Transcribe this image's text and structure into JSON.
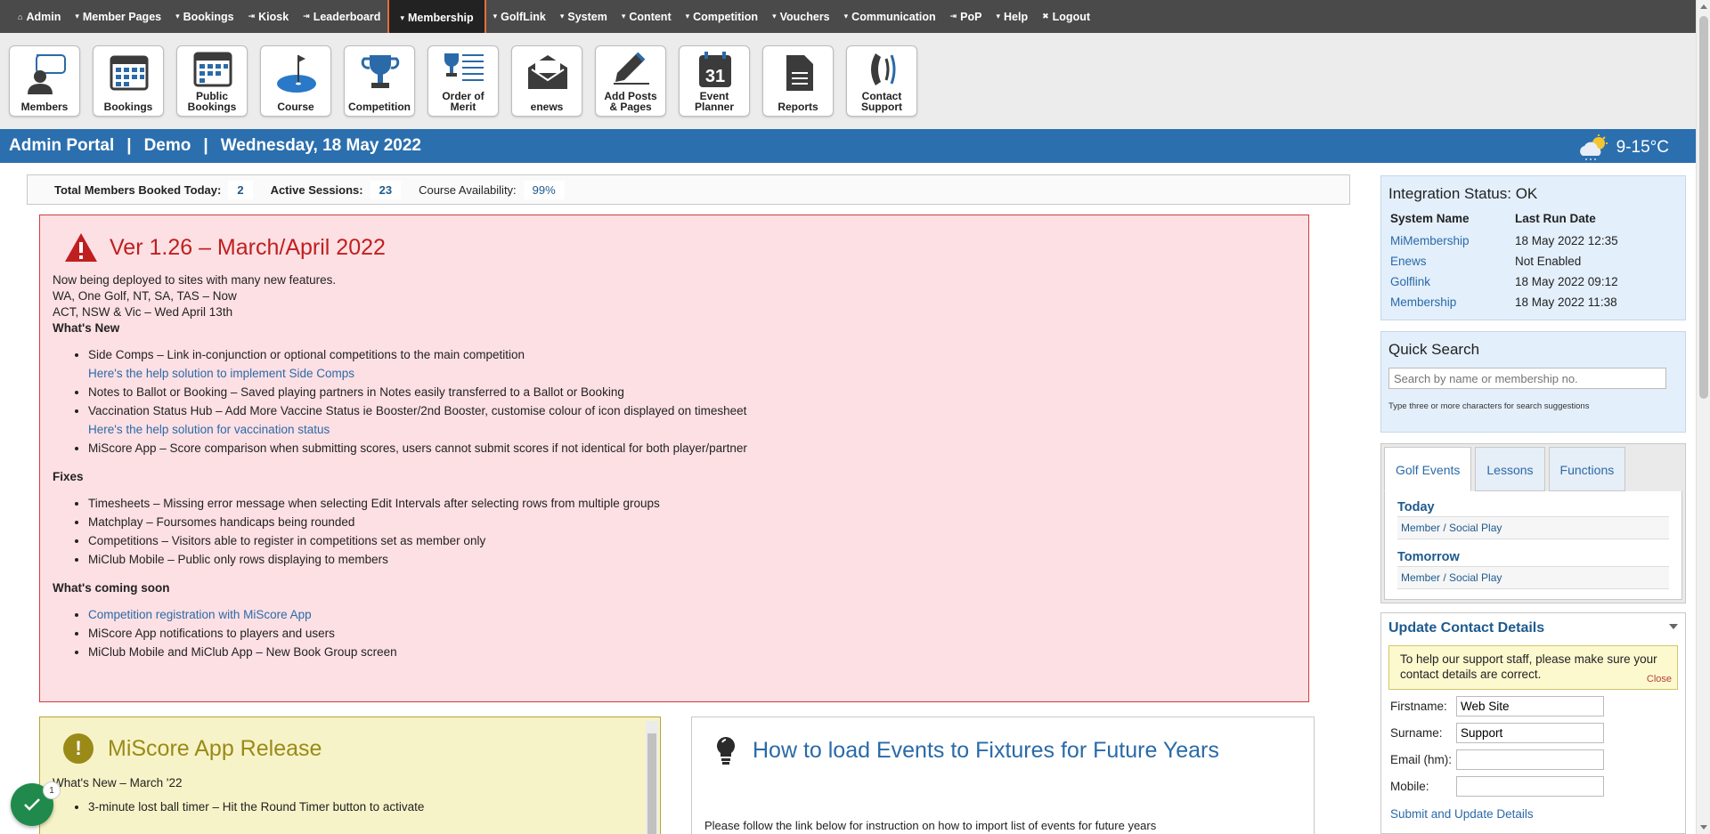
{
  "nav": {
    "items": [
      {
        "glyph": "⌂",
        "label": "Admin"
      },
      {
        "glyph": "▾",
        "label": "Member Pages"
      },
      {
        "glyph": "▾",
        "label": "Bookings"
      },
      {
        "glyph": "⇥",
        "label": "Kiosk"
      },
      {
        "glyph": "⇥",
        "label": "Leaderboard"
      },
      {
        "glyph": "▾",
        "label": "Membership"
      },
      {
        "glyph": "▾",
        "label": "GolfLink"
      },
      {
        "glyph": "▾",
        "label": "System"
      },
      {
        "glyph": "▾",
        "label": "Content"
      },
      {
        "glyph": "▾",
        "label": "Competition"
      },
      {
        "glyph": "▾",
        "label": "Vouchers"
      },
      {
        "glyph": "▾",
        "label": "Communication"
      },
      {
        "glyph": "⇥",
        "label": "PoP"
      },
      {
        "glyph": "▾",
        "label": "Help"
      },
      {
        "glyph": "✖",
        "label": "Logout"
      }
    ],
    "active": "Membership"
  },
  "toolbar": {
    "members": "Members",
    "bookings": "Bookings",
    "public_bookings_1": "Public",
    "public_bookings_2": "Bookings",
    "course": "Course",
    "competition": "Competition",
    "order_of_merit_1": "Order of",
    "order_of_merit_2": "Merit",
    "enews": "enews",
    "add_posts_1": "Add Posts",
    "add_posts_2": "& Pages",
    "event_planner_1": "Event",
    "event_planner_2": "Planner",
    "event_planner_day": "31",
    "reports": "Reports",
    "contact_support_1": "Contact",
    "contact_support_2": "Support"
  },
  "banner": {
    "portal": "Admin Portal",
    "sep": "|",
    "club": "Demo",
    "date": "Wednesday, 18 May 2022",
    "temp": "9-15°C"
  },
  "stats": {
    "booked_label": "Total Members Booked Today:",
    "booked_value": "2",
    "sessions_label": "Active Sessions:",
    "sessions_value": "23",
    "availability_label": "Course Availability:",
    "availability_value": "99%"
  },
  "notice": {
    "title": "Ver 1.26 – March/April 2022",
    "intro1": "Now being deployed to sites with many new features.",
    "intro2": "WA, One Golf, NT, SA, TAS – Now",
    "intro3": "ACT, NSW & Vic – Wed April 13th",
    "whats_new": "What's New",
    "new_items": [
      "Side Comps – Link in-conjunction or optional competitions to the main competition",
      "Notes to Ballot or Booking – Saved playing partners in Notes easily transferred to a Ballot or Booking",
      "Vaccination Status Hub – Add More Vaccine Status ie Booster/2nd Booster, customise colour of icon displayed on timesheet",
      "MiScore App – Score comparison when submitting scores, users cannot submit scores if not identical for both player/partner"
    ],
    "link_side_comps": "Here's the help solution to implement Side Comps",
    "link_vaccination": "Here's the help solution for vaccination status",
    "fixes": "Fixes",
    "fix_items": [
      "Timesheets – Missing error message when selecting Edit Intervals after selecting rows from multiple groups",
      "Matchplay – Foursomes handicaps being rounded",
      "Competitions – Visitors able to register in competitions set as member only",
      "MiClub Mobile – Public only rows displaying to members"
    ],
    "coming": "What's coming soon",
    "coming_link": "Competition registration with MiScore App",
    "coming_items": [
      "MiScore App notifications to players and users",
      "MiClub Mobile and MiClub App – New Book Group screen"
    ]
  },
  "miscore": {
    "title": "MiScore App Release",
    "text": "What's New – March '22",
    "item1": "3-minute lost ball timer – Hit the Round Timer button to activate"
  },
  "howto": {
    "title": "How to load Events to Fixtures for Future Years",
    "text": "Please follow the link below for instruction on how to import list of events for future years"
  },
  "integration": {
    "title": "Integration Status: OK",
    "col_name": "System Name",
    "col_date": "Last Run Date",
    "rows": [
      {
        "name": "MiMembership",
        "date": "18 May 2022 12:35"
      },
      {
        "name": "Enews",
        "date": "Not Enabled"
      },
      {
        "name": "Golflink",
        "date": "18 May 2022 09:12"
      },
      {
        "name": "Membership",
        "date": "18 May 2022 11:38"
      }
    ]
  },
  "quick_search": {
    "title": "Quick Search",
    "placeholder": "Search by name or membership no.",
    "hint": "Type three or more characters for search suggestions"
  },
  "events": {
    "tabs": [
      "Golf Events",
      "Lessons",
      "Functions"
    ],
    "today": "Today",
    "today_item": "Member / Social Play",
    "tomorrow": "Tomorrow",
    "tomorrow_item": "Member / Social Play"
  },
  "contact": {
    "title": "Update Contact Details",
    "note": "To help our support staff, please make sure your contact details are correct.",
    "close": "Close",
    "firstname_label": "Firstname:",
    "firstname_value": "Web Site",
    "surname_label": "Surname:",
    "surname_value": "Support",
    "email_label": "Email (hm):",
    "mobile_label": "Mobile:",
    "submit": "Submit and Update Details"
  },
  "float": {
    "badge": "1"
  }
}
